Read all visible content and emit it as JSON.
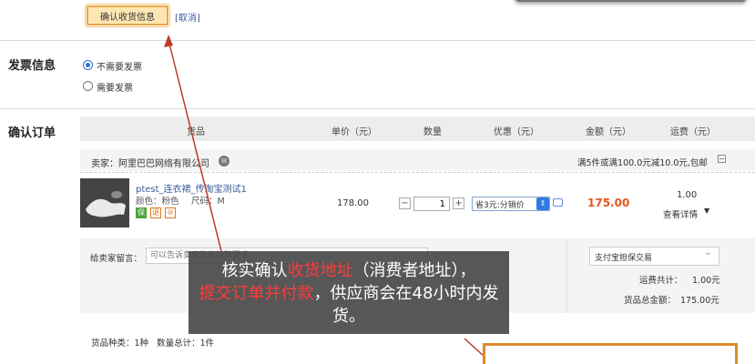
{
  "address": {
    "confirm_button": "确认收货信息",
    "cancel_link": "[取消]"
  },
  "invoice": {
    "section_title": "发票信息",
    "options": [
      "不需要发票",
      "需要发票"
    ],
    "selected_index": 0
  },
  "order": {
    "section_title": "确认订单",
    "columns": [
      "货品",
      "单价（元）",
      "数量",
      "优惠（元）",
      "金额（元）",
      "运费（元）"
    ],
    "seller": {
      "label": "卖家：阿里巴巴网络有限公司",
      "promo": "满5件或满100.0元减10.0元,包邮"
    },
    "item": {
      "name": "ptest_连衣裙_传淘宝测试1",
      "color": "颜色：粉色",
      "size": "尺码：M",
      "badges": [
        "保",
        "退",
        "⑩"
      ],
      "unit_price": "178.00",
      "quantity": "1",
      "qty_minus": "−",
      "qty_plus": "+",
      "discount_option": "省3元:分销价",
      "amount": "175.00",
      "shipping_fee": "1.00",
      "shipping_detail": "查看详情"
    },
    "message": {
      "label": "给卖家留言：",
      "placeholder": "可以告诉卖家您的特殊要求"
    },
    "trade_type": "支付宝担保交易",
    "shipping_total_label": "运费共计：",
    "shipping_total": "1.00元",
    "goods_total_label": "货品总金额：",
    "goods_total": "175.00元",
    "summary": "货品种类：1种   数量总计：1件"
  },
  "caption": {
    "part1": "核实确认",
    "part2_red": "收货地址",
    "part3": "（消费者地址），",
    "part4_red": "提交订单并付款",
    "part5": "，供应商会在48小时内发货。"
  },
  "colors": {
    "accent_red": "#ff3b3b",
    "amount_orange": "#e4571f",
    "highlight_box": "#e08a2c",
    "arrow": "#c0392b"
  }
}
